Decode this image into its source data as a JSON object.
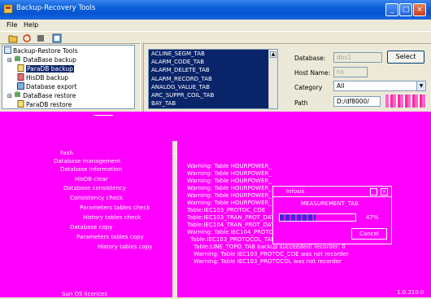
{
  "window": {
    "title": "Backup-Recovery Tools"
  },
  "menu": [
    "File",
    "Help"
  ],
  "toolbar_icons": [
    "open-icon",
    "refresh-icon",
    "stop-icon",
    "export-icon"
  ],
  "tree": {
    "root": "Backup-Restore Tools",
    "items": [
      {
        "label": "DataBase backup",
        "icon": "database-icon",
        "selected": false
      },
      {
        "label": "ParaDB backup",
        "icon": "document-icon",
        "selected": true
      },
      {
        "label": "HisDB backup",
        "icon": "document-icon",
        "selected": false
      },
      {
        "label": "Database export",
        "icon": "export-icon",
        "selected": false
      },
      {
        "label": "DataBase restore",
        "icon": "database-icon",
        "selected": false
      },
      {
        "label": "ParaDB restore",
        "icon": "document-icon",
        "selected": false
      }
    ]
  },
  "table_list": [
    "ACLINE_SEGM_TAB",
    "ALARM_CODE_TAB",
    "ALARM_DELETE_TAB",
    "ALARM_RECORD_TAB",
    "ANALOG_VALUE_TAB",
    "ARC_SUPPR_COIL_TAB",
    "BAY_TAB"
  ],
  "form": {
    "database_label": "Database:",
    "database_value": "dbs1",
    "select_button": "Select",
    "host_label": "Host Name:",
    "host_value": "hh",
    "category_label": "Category",
    "category_value": "All",
    "path_label": "Path",
    "path_value": "D:/df8000/"
  },
  "lower_tree": {
    "items": [
      "Fash",
      "Database management",
      "Database information",
      "HisDB clear",
      "Database consistency",
      "Consistency check",
      "Parameters tables check",
      "History tables check",
      "Database copy",
      "Parameters tables copy",
      "History tables copy",
      "Sun OS licences"
    ]
  },
  "log": {
    "lines": [
      "Warning: Table HOURPOWER_",
      "Warning: Table HOURPOWER_",
      "Warning: Table HOURPOWER_",
      "Warning: Table HOURPOWER_",
      "Warning: Table HOURPOWER_",
      "Warning: Table HOURPOWER_",
      "Table:IEC103_PROTOC_COE",
      "Table:IEC103_TRAN_PROT_DATA_TAB backup succeeded! recorder: 0",
      "Table:IEC104_TRAN_PROT_DATA_TAB backup succeeded! recorder: 0",
      "Warning: Table IEC104_PROTOCOL_COE",
      "Table:IEC103_PROTOCOL_TAB backup succeeded! recorder:",
      "Table:LINE_TOPO_TAB backup succeeded! recorder: 0",
      "Warning: Table IEC103_PROTOC_COE was not recorder",
      "Warning: Table IEC103_PROTOCOL was not recorder"
    ],
    "status_right": "1.0.210.0"
  },
  "progress_dialog": {
    "title": "Infosis",
    "table": "MEASUREMENT_TAB",
    "percent_text": "47%",
    "progress": 0.47,
    "cancel": "Cancel"
  },
  "colors": {
    "title_blue": "#0454d2",
    "selection": "#0a246a",
    "overlay": "#ff00ff"
  }
}
